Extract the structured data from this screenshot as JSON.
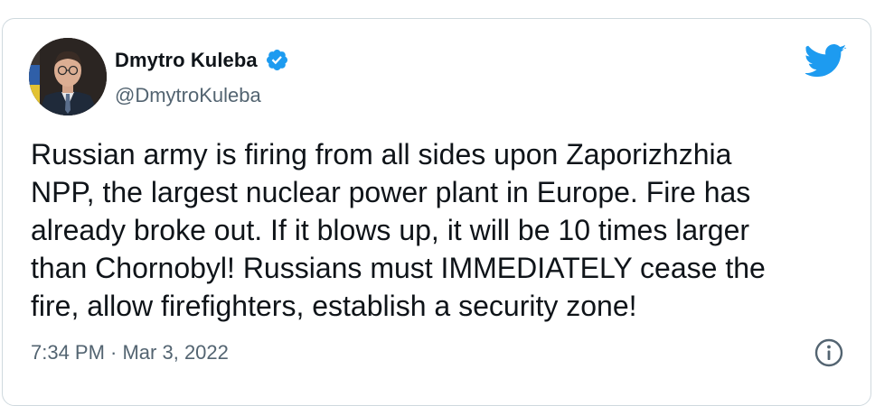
{
  "author": {
    "display_name": "Dmytro Kuleba",
    "handle": "@DmytroKuleba",
    "verified": true
  },
  "tweet": {
    "text": "Russian army is firing from all sides upon Zaporizhzhia\nNPP, the largest nuclear power plant in Europe. Fire has\nalready broke out. If it blows up, it will be 10 times larger\nthan Chornobyl! Russians must IMMEDIATELY cease the\nfire, allow firefighters, establish a security zone!",
    "timestamp": "7:34 PM · Mar 3, 2022"
  },
  "icons": {
    "brand": "twitter-bird-icon",
    "verified": "verified-badge-icon",
    "info": "info-icon"
  },
  "colors": {
    "twitter_blue": "#1d9bf0",
    "text_primary": "#0f1419",
    "text_secondary": "#536471",
    "border": "#cfd9de"
  }
}
